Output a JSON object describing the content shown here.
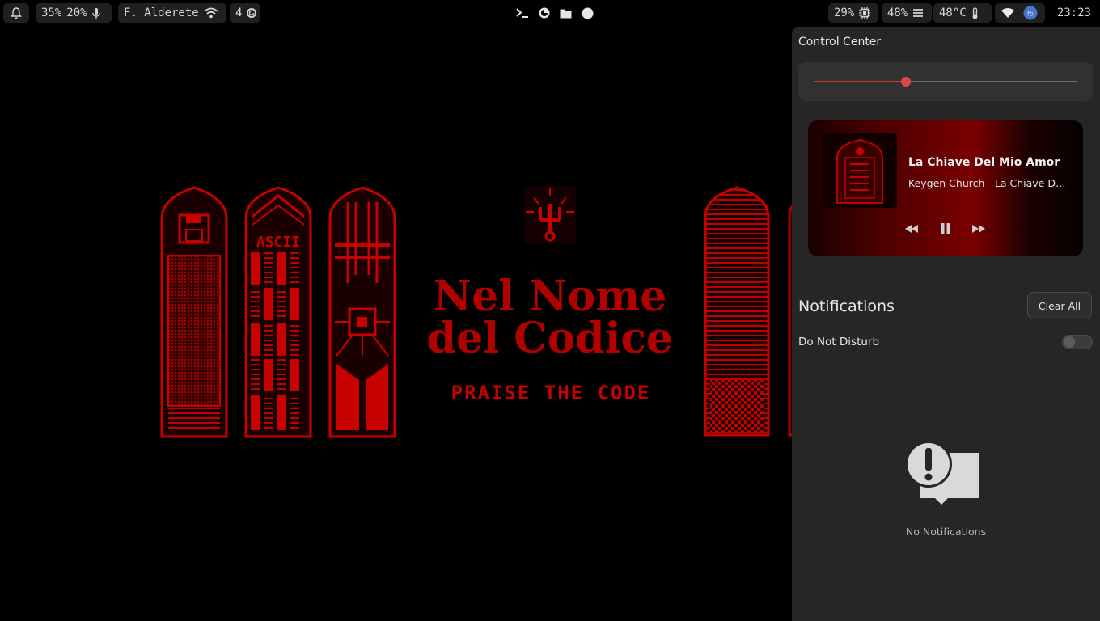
{
  "topbar": {
    "left": {
      "bell_icon": "bell-icon",
      "mem_usage": "35%",
      "swap_usage": "20%",
      "mic_icon": "microphone-icon",
      "user_name": "F. Alderete",
      "wifi_icon": "wifi-icon",
      "workspace": "4",
      "workspace_icon": "circle-arrow-icon"
    },
    "center": {
      "apps": [
        "terminal-icon",
        "browser-icon",
        "folder-icon",
        "circle-icon"
      ]
    },
    "right": {
      "cpu": "29%",
      "cpu_icon": "cpu-icon",
      "disk": "48%",
      "disk_icon": "bars-icon",
      "temp": "48°C",
      "temp_icon": "thermometer-icon",
      "network_icon": "wifi-icon",
      "avatar_icon": "avatar-icon",
      "clock": "23:23"
    }
  },
  "wallpaper": {
    "title_line1": "Nel Nome",
    "title_line2": "del Codice",
    "tagline": "PRAISE THE CODE",
    "window_label": "ASCII",
    "accent": "#c80000"
  },
  "control_center": {
    "title": "Control Center",
    "volume": {
      "level": 0.35,
      "accent": "#d33636"
    },
    "media": {
      "title": "La Chiave Del Mio Amor",
      "artist": "Keygen Church - La Chiave Del Mio Amor",
      "prev_icon": "rewind-icon",
      "pause_icon": "pause-icon",
      "next_icon": "fast-forward-icon"
    },
    "notifications": {
      "heading": "Notifications",
      "clear_all": "Clear All",
      "dnd_label": "Do Not Disturb",
      "dnd_enabled": false,
      "empty_icon": "notification-alert-icon",
      "empty_text": "No Notifications"
    }
  }
}
